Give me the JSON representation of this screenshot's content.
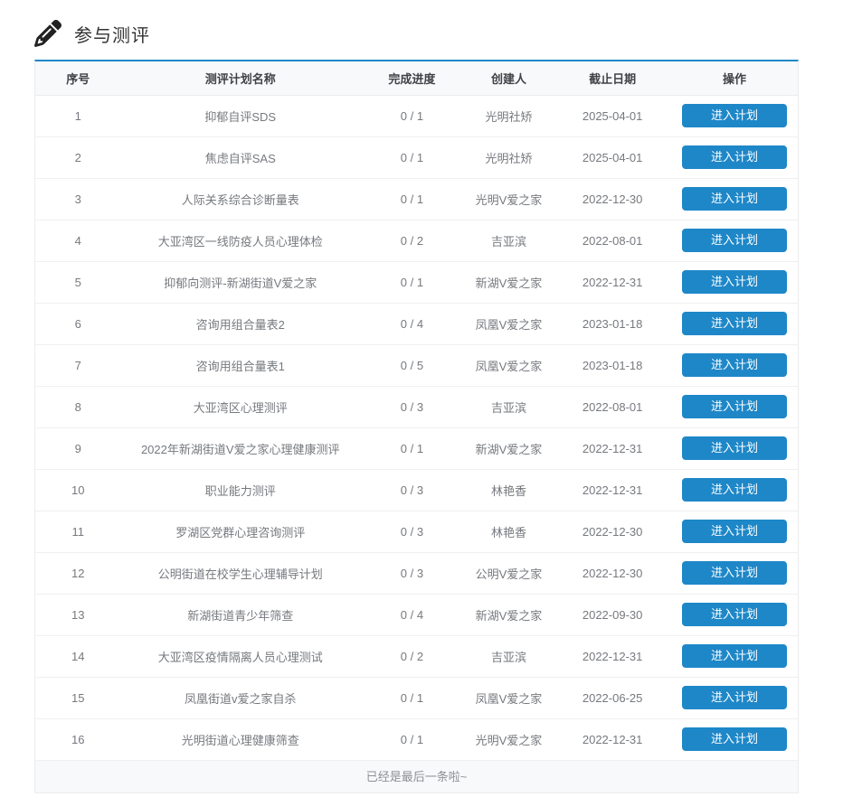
{
  "page": {
    "title": "参与测评"
  },
  "colors": {
    "accent_blue": "#1e87c8",
    "header_bg": "#f8f9fa",
    "footer_bg": "#f8f9fa"
  },
  "icons": {
    "title_icon": "pencil-icon"
  },
  "table": {
    "headers": [
      "序号",
      "测评计划名称",
      "完成进度",
      "创建人",
      "截止日期",
      "操作"
    ],
    "action_label": "进入计划",
    "footer_note": "已经是最后一条啦~",
    "rows": [
      {
        "no": "1",
        "name": "抑郁自评SDS",
        "progress": "0 / 1",
        "creator": "光明社矫",
        "deadline": "2025-04-01"
      },
      {
        "no": "2",
        "name": "焦虑自评SAS",
        "progress": "0 / 1",
        "creator": "光明社矫",
        "deadline": "2025-04-01"
      },
      {
        "no": "3",
        "name": "人际关系综合诊断量表",
        "progress": "0 / 1",
        "creator": "光明V爱之家",
        "deadline": "2022-12-30"
      },
      {
        "no": "4",
        "name": "大亚湾区一线防疫人员心理体检",
        "progress": "0 / 2",
        "creator": "吉亚滨",
        "deadline": "2022-08-01"
      },
      {
        "no": "5",
        "name": "抑郁向测评-新湖街道V爱之家",
        "progress": "0 / 1",
        "creator": "新湖V爱之家",
        "deadline": "2022-12-31"
      },
      {
        "no": "6",
        "name": "咨询用组合量表2",
        "progress": "0 / 4",
        "creator": "凤凰V爱之家",
        "deadline": "2023-01-18"
      },
      {
        "no": "7",
        "name": "咨询用组合量表1",
        "progress": "0 / 5",
        "creator": "凤凰V爱之家",
        "deadline": "2023-01-18"
      },
      {
        "no": "8",
        "name": "大亚湾区心理测评",
        "progress": "0 / 3",
        "creator": "吉亚滨",
        "deadline": "2022-08-01"
      },
      {
        "no": "9",
        "name": "2022年新湖街道V爱之家心理健康测评",
        "progress": "0 / 1",
        "creator": "新湖V爱之家",
        "deadline": "2022-12-31"
      },
      {
        "no": "10",
        "name": "职业能力测评",
        "progress": "0 / 3",
        "creator": "林艳香",
        "deadline": "2022-12-31"
      },
      {
        "no": "11",
        "name": "罗湖区党群心理咨询测评",
        "progress": "0 / 3",
        "creator": "林艳香",
        "deadline": "2022-12-30"
      },
      {
        "no": "12",
        "name": "公明街道在校学生心理辅导计划",
        "progress": "0 / 3",
        "creator": "公明V爱之家",
        "deadline": "2022-12-30"
      },
      {
        "no": "13",
        "name": "新湖街道青少年筛查",
        "progress": "0 / 4",
        "creator": "新湖V爱之家",
        "deadline": "2022-09-30"
      },
      {
        "no": "14",
        "name": "大亚湾区疫情隔离人员心理测试",
        "progress": "0 / 2",
        "creator": "吉亚滨",
        "deadline": "2022-12-31"
      },
      {
        "no": "15",
        "name": "凤凰街道v爱之家自杀",
        "progress": "0 / 1",
        "creator": "凤凰V爱之家",
        "deadline": "2022-06-25"
      },
      {
        "no": "16",
        "name": "光明街道心理健康筛查",
        "progress": "0 / 1",
        "creator": "光明V爱之家",
        "deadline": "2022-12-31"
      }
    ]
  }
}
